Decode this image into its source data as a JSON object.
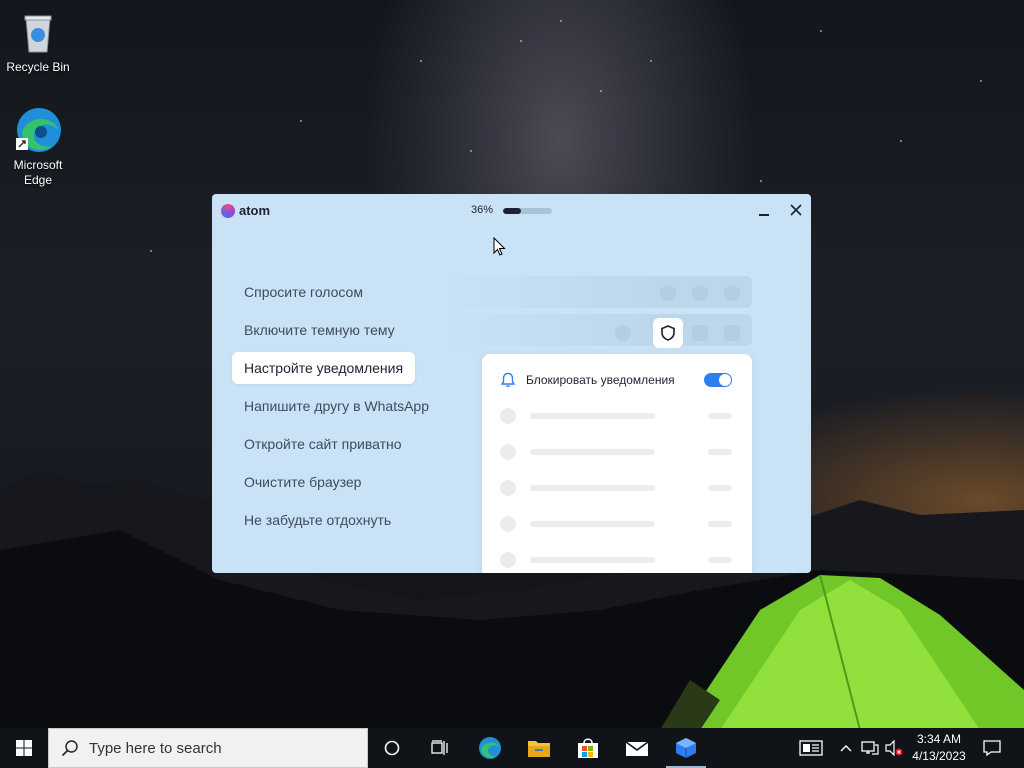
{
  "desktop": {
    "icons": [
      {
        "label": "Recycle Bin",
        "icon": "recycle-bin-icon"
      },
      {
        "label": "Microsoft Edge",
        "icon": "edge-icon"
      }
    ]
  },
  "installer": {
    "brand": "atom",
    "progress_label": "36%",
    "progress_value": 36,
    "menu_items": [
      {
        "label": "Спросите голосом",
        "active": false
      },
      {
        "label": "Включите темную тему",
        "active": false
      },
      {
        "label": "Настройте уведомления",
        "active": true
      },
      {
        "label": "Напишите другу в WhatsApp",
        "active": false
      },
      {
        "label": "Откройте сайт приватно",
        "active": false
      },
      {
        "label": "Очистите браузер",
        "active": false
      },
      {
        "label": "Не забудьте отдохнуть",
        "active": false
      }
    ],
    "panel": {
      "title": "Блокировать уведомления",
      "toggle_on": true,
      "icon": "bell-icon"
    },
    "colors": {
      "window_bg": "#c9e2f6",
      "accent": "#2f7ef0",
      "text_dark": "#1d2233"
    }
  },
  "taskbar": {
    "search_placeholder": "Type here to search",
    "apps": [
      "cortana-icon",
      "task-view-icon",
      "edge-icon",
      "file-explorer-icon",
      "store-icon",
      "mail-icon",
      "atom-installer-icon"
    ],
    "time": "3:34 AM",
    "date": "4/13/2023"
  }
}
